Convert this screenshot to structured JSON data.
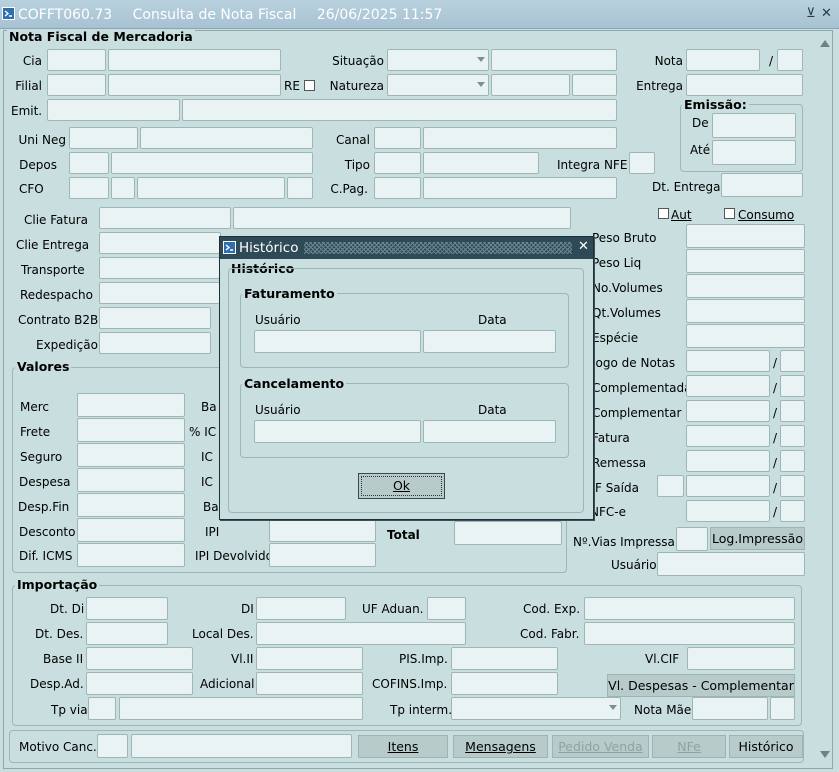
{
  "window": {
    "code": "COFFT060.73",
    "title": "Consulta de Nota Fiscal",
    "datetime": "26/06/2025 11:57",
    "minimize_glyph": "⊻",
    "close_glyph": "✕"
  },
  "section_title": "Nota Fiscal de Mercadoria",
  "labels": {
    "cia": "Cia",
    "filial": "Filial",
    "re": "RE",
    "emit": "Emit.",
    "situacao": "Situação",
    "natureza": "Natureza",
    "nota": "Nota",
    "slash": "/",
    "entrega": "Entrega",
    "emissao": "Emissão:",
    "de": "De",
    "ate": "Até",
    "uni_neg": "Uni Neg",
    "depos": "Depos",
    "cfo": "CFO",
    "canal": "Canal",
    "tipo": "Tipo",
    "cpag": "C.Pag.",
    "integra_nfe": "Integra NFE",
    "dt_entrega": "Dt. Entrega",
    "aut": "Aut",
    "consumo": "Consumo",
    "clie_fatura": "Clie Fatura",
    "clie_entrega": "Clie Entrega",
    "transporte": "Transporte",
    "redespacho": "Redespacho",
    "contrato_b2b": "Contrato B2B",
    "expedicao": "Expedição",
    "peso_bruto": "Peso Bruto",
    "peso_liq": "Peso Liq",
    "no_volumes": "No.Volumes",
    "qt_volumes": "Qt.Volumes",
    "especie": "Espécie",
    "jogo_notas": "Jogo de Notas",
    "complementada": "Complementada",
    "complementar": "Complementar",
    "fatura": "Fatura",
    "remessa": "Remessa",
    "nf_saida": "NF Saída",
    "nfc_e": "NFC-e",
    "valores": "Valores",
    "merc": "Merc",
    "frete": "Frete",
    "seguro": "Seguro",
    "despesa": "Despesa",
    "desp_fin": "Desp.Fin",
    "desconto": "Desconto",
    "dif_icms": "Dif. ICMS",
    "ba1": "Ba",
    "pct_icms": "% IC",
    "icms1": "IC",
    "icms2": "IC",
    "ba2": "Ba",
    "ipi": "IPI",
    "ipi_devolvido": "IPI Devolvido",
    "total": "Total",
    "vias_impressa": "Nº.Vias Impressa",
    "usuario": "Usuário",
    "importacao": "Importação",
    "dt_di": "Dt. Di",
    "di": "DI",
    "uf_aduan": "UF Aduan.",
    "cod_exp": "Cod. Exp.",
    "dt_des": "Dt. Des.",
    "local_des": "Local Des.",
    "cod_fabr": "Cod. Fabr.",
    "base_ii": "Base II",
    "vl_ii": "Vl.II",
    "pis_imp": "PIS.Imp.",
    "vl_cif": "Vl.CIF",
    "desp_ad": "Desp.Ad.",
    "adicional": "Adicional",
    "cofins_imp": "COFINS.Imp.",
    "tp_via": "Tp via",
    "tp_interm": "Tp interm.",
    "nota_mae": "Nota Mãe",
    "motivo_canc": "Motivo Canc."
  },
  "buttons": {
    "log_impressao": "Log.Impressão",
    "vl_despesas": "Vl. Despesas - Complementar",
    "itens": "Itens",
    "mensagens": "Mensagens",
    "pedido_venda": "Pedido Venda",
    "nfe": "NFe",
    "historico": "Histórico"
  },
  "dialog": {
    "title": "Histórico",
    "group_title": "Histórico",
    "faturamento": "Faturamento",
    "cancelamento": "Cancelamento",
    "usuario": "Usuário",
    "data": "Data",
    "ok": "Ok",
    "close_glyph": "✕"
  },
  "colors": {
    "background": "#c9dede",
    "field": "#eaf3f3",
    "dialog_titlebar": "#2e4a57",
    "button": "#b8cbcb"
  }
}
